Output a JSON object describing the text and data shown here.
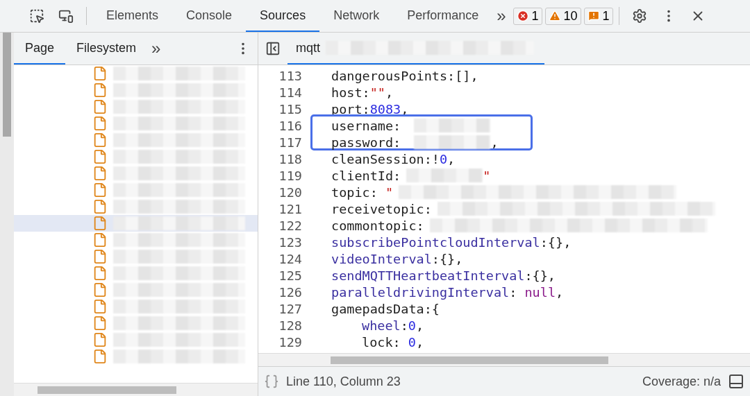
{
  "toolbar": {
    "tabs": [
      {
        "label": "Elements",
        "selected": false
      },
      {
        "label": "Console",
        "selected": false
      },
      {
        "label": "Sources",
        "selected": true
      },
      {
        "label": "Network",
        "selected": false
      },
      {
        "label": "Performance",
        "selected": false
      }
    ],
    "more": "»",
    "counters": [
      {
        "kind": "error",
        "count": "1"
      },
      {
        "kind": "warning",
        "count": "10"
      },
      {
        "kind": "issue",
        "count": "1"
      }
    ]
  },
  "navigator": {
    "tabs": [
      {
        "label": "Page",
        "selected": true
      },
      {
        "label": "Filesystem",
        "selected": false
      }
    ],
    "more": "»",
    "files": [
      {
        "selected": false
      },
      {
        "selected": false
      },
      {
        "selected": false
      },
      {
        "selected": false
      },
      {
        "selected": false
      },
      {
        "selected": false
      },
      {
        "selected": false
      },
      {
        "selected": false
      },
      {
        "selected": false
      },
      {
        "selected": true
      },
      {
        "selected": false
      },
      {
        "selected": false
      },
      {
        "selected": false
      },
      {
        "selected": false
      },
      {
        "selected": false
      },
      {
        "selected": false
      },
      {
        "selected": false
      },
      {
        "selected": false
      }
    ]
  },
  "editor": {
    "tab": {
      "label": "mqtt",
      "selected": true
    },
    "lines": [
      {
        "number": "113",
        "boxed": false,
        "tokens": [
          {
            "kind": "plain",
            "text": "dangerousPoints:[],"
          }
        ]
      },
      {
        "number": "114",
        "boxed": false,
        "tokens": [
          {
            "kind": "plain",
            "text": "host:"
          },
          {
            "kind": "string",
            "text": "\"\""
          },
          {
            "kind": "plain",
            "text": ","
          }
        ]
      },
      {
        "number": "115",
        "boxed": false,
        "tokens": [
          {
            "kind": "plain",
            "text": "port:"
          },
          {
            "kind": "number",
            "text": "8083"
          },
          {
            "kind": "plain",
            "text": ","
          }
        ]
      },
      {
        "number": "116",
        "boxed": true,
        "tokens": [
          {
            "kind": "plain",
            "text": "username: "
          },
          {
            "kind": "redaction"
          }
        ]
      },
      {
        "number": "117",
        "boxed": true,
        "tokens": [
          {
            "kind": "plain",
            "text": "password: "
          },
          {
            "kind": "redaction"
          },
          {
            "kind": "plain",
            "text": ","
          }
        ]
      },
      {
        "number": "118",
        "boxed": false,
        "tokens": [
          {
            "kind": "plain",
            "text": "cleanSession:!"
          },
          {
            "kind": "number",
            "text": "0"
          },
          {
            "kind": "plain",
            "text": ","
          }
        ]
      },
      {
        "number": "119",
        "boxed": false,
        "tokens": [
          {
            "kind": "plain",
            "text": "clientId:"
          },
          {
            "kind": "redaction"
          },
          {
            "kind": "string",
            "text": "\""
          }
        ]
      },
      {
        "number": "120",
        "boxed": false,
        "tokens": [
          {
            "kind": "plain",
            "text": "topic: "
          },
          {
            "kind": "string",
            "text": "\""
          },
          {
            "kind": "redaction"
          }
        ]
      },
      {
        "number": "121",
        "boxed": false,
        "tokens": [
          {
            "kind": "plain",
            "text": "receivetopic:"
          },
          {
            "kind": "redaction"
          }
        ]
      },
      {
        "number": "122",
        "boxed": false,
        "tokens": [
          {
            "kind": "plain",
            "text": "commontopic:"
          },
          {
            "kind": "redaction"
          }
        ]
      },
      {
        "number": "123",
        "boxed": false,
        "tokens": [
          {
            "kind": "property",
            "text": "subscribePointcloudInterval"
          },
          {
            "kind": "plain",
            "text": ":{},"
          }
        ]
      },
      {
        "number": "124",
        "boxed": false,
        "tokens": [
          {
            "kind": "property",
            "text": "videoInterval"
          },
          {
            "kind": "plain",
            "text": ":{},"
          }
        ]
      },
      {
        "number": "125",
        "boxed": false,
        "tokens": [
          {
            "kind": "property",
            "text": "sendMQTTHeartbeatInterval"
          },
          {
            "kind": "plain",
            "text": ":{},"
          }
        ]
      },
      {
        "number": "126",
        "boxed": false,
        "tokens": [
          {
            "kind": "property",
            "text": "paralleldrivingInterval"
          },
          {
            "kind": "plain",
            "text": ": "
          },
          {
            "kind": "keyword",
            "text": "null"
          },
          {
            "kind": "plain",
            "text": ","
          }
        ]
      },
      {
        "number": "127",
        "boxed": false,
        "tokens": [
          {
            "kind": "plain",
            "text": "gamepadsData:{"
          }
        ],
        "children": [
          {
            "number": "128",
            "boxed": false,
            "tokens": [
              {
                "kind": "property",
                "text": "wheel"
              },
              {
                "kind": "plain",
                "text": ":"
              },
              {
                "kind": "number",
                "text": "0"
              },
              {
                "kind": "plain",
                "text": ","
              }
            ]
          },
          {
            "number": "129",
            "boxed": false,
            "tokens": [
              {
                "kind": "plain",
                "text": "lock: "
              },
              {
                "kind": "number",
                "text": "0"
              },
              {
                "kind": "plain",
                "text": ","
              }
            ]
          }
        ]
      }
    ]
  },
  "status_bar": {
    "position": "Line 110, Column 23",
    "coverage": "Coverage: n/a"
  }
}
